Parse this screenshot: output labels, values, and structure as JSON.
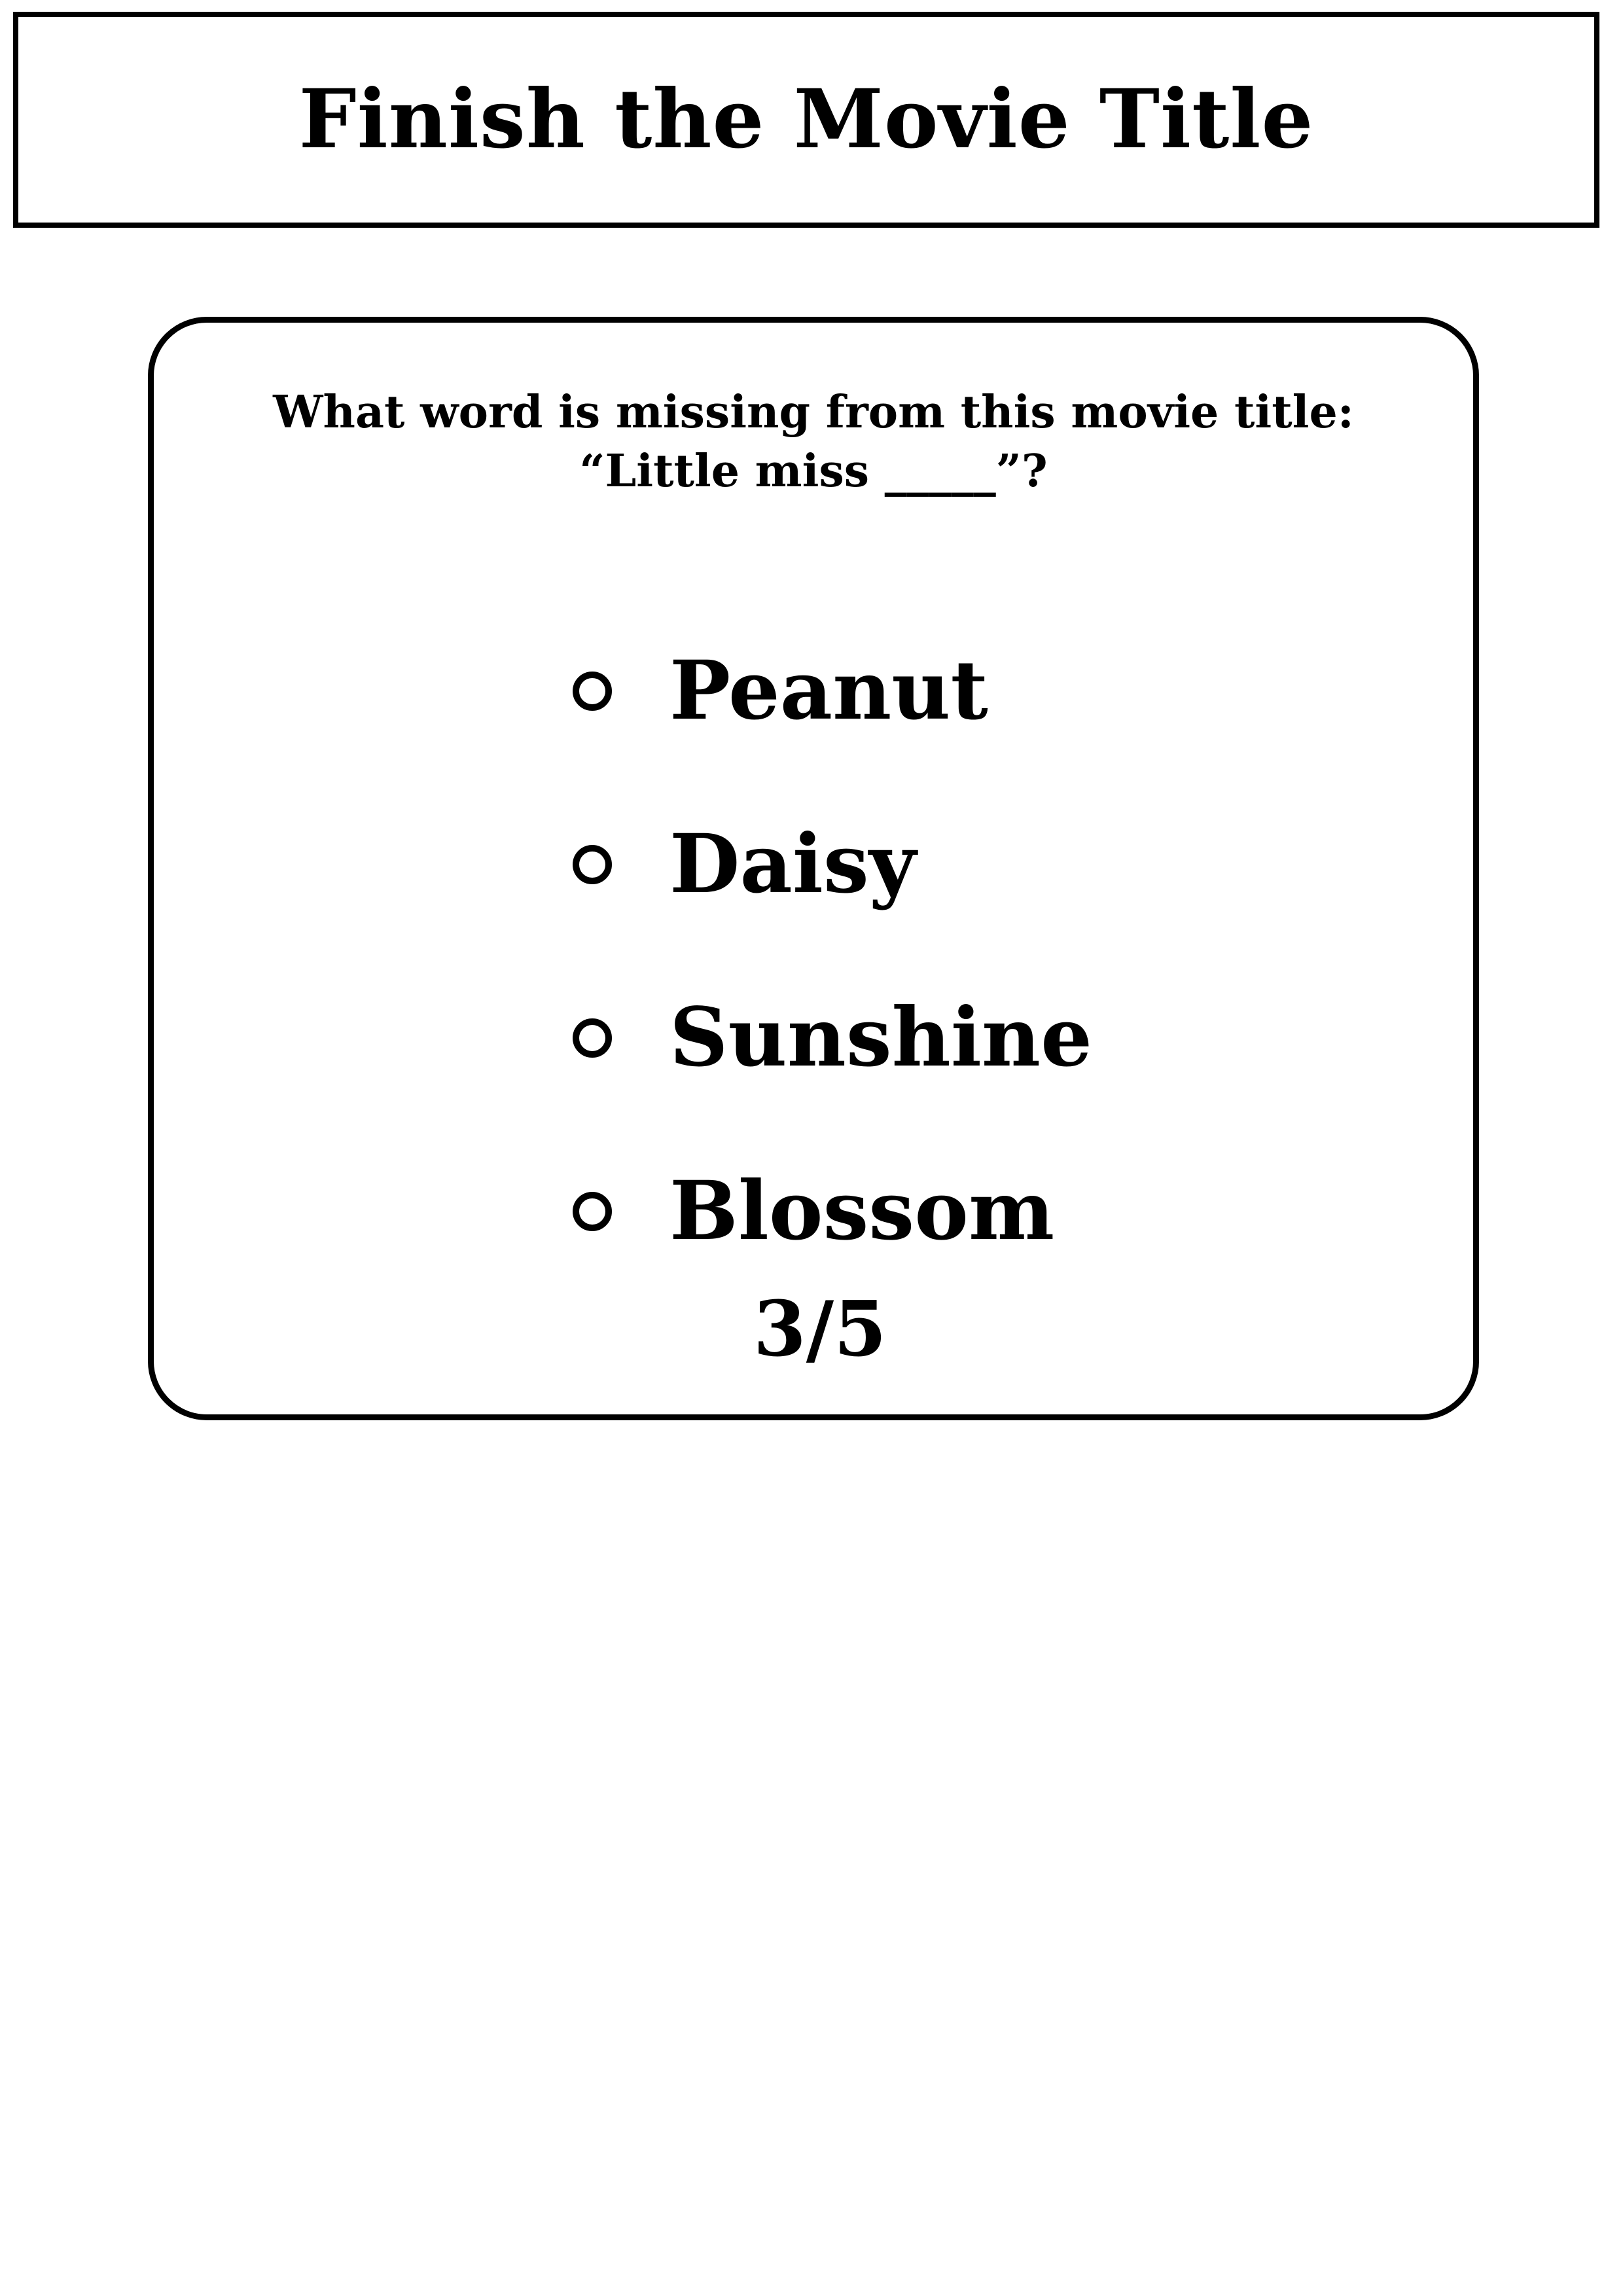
{
  "header": {
    "title": "Finish the Movie Title"
  },
  "question": {
    "line1": "What word is missing from this movie title:",
    "line2": "“Little miss _____”?"
  },
  "options": [
    {
      "label": "Peanut"
    },
    {
      "label": "Daisy"
    },
    {
      "label": "Sunshine"
    },
    {
      "label": "Blossom"
    }
  ],
  "progress": {
    "text": "3/5"
  }
}
